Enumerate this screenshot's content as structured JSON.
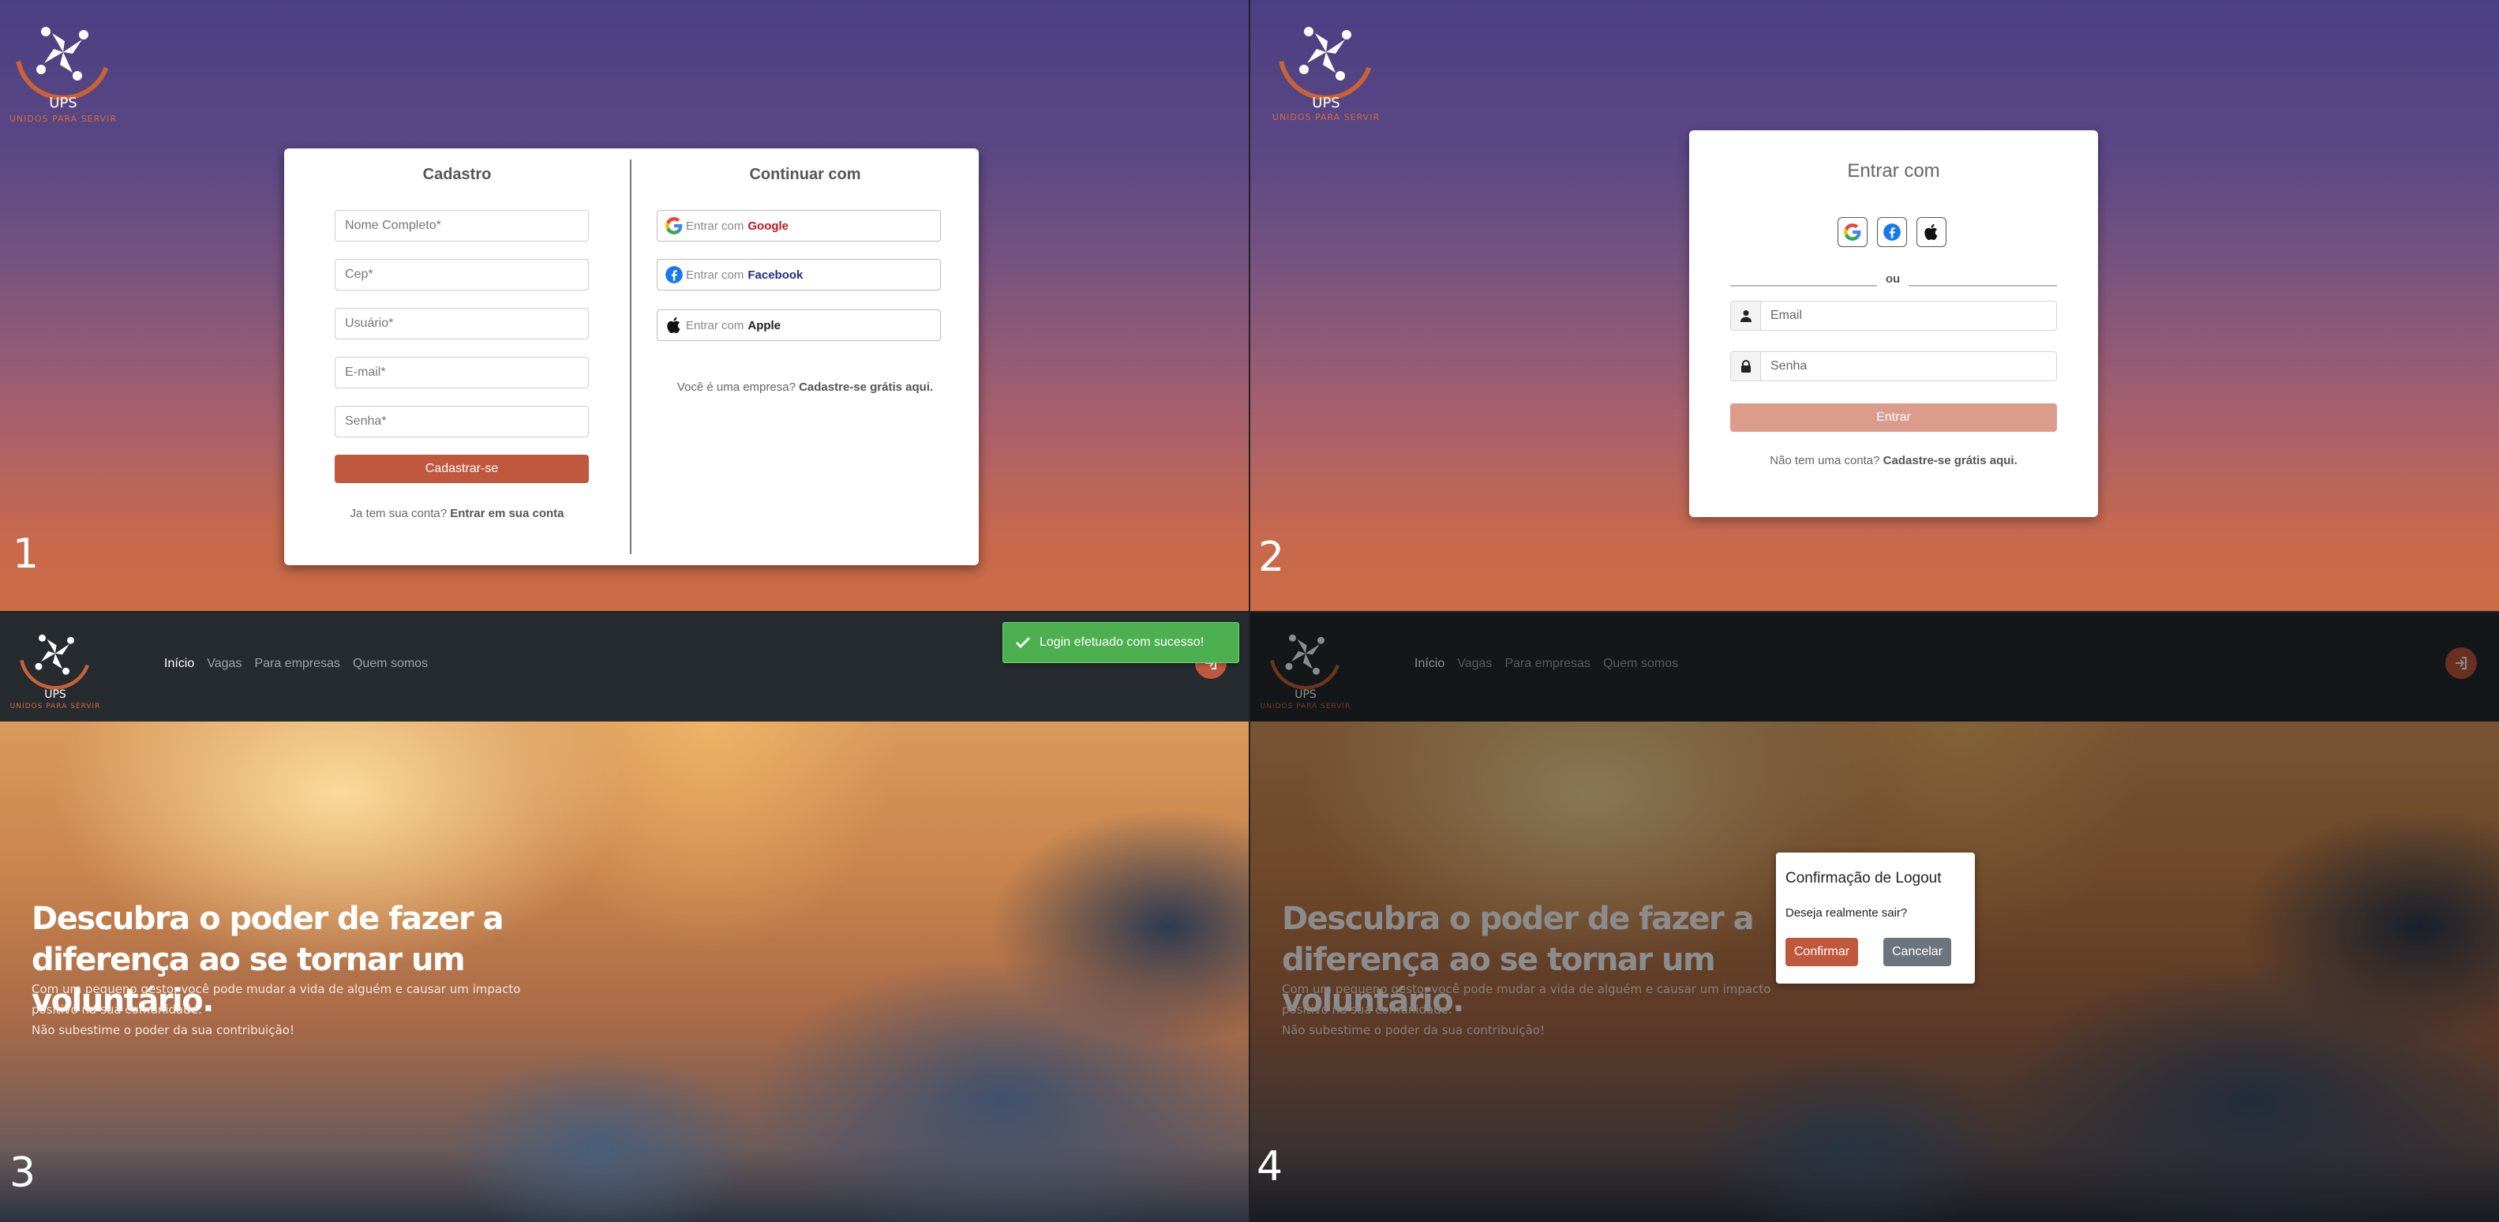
{
  "brand": {
    "name": "UPS",
    "tagline": "UNIDOS PARA SERVIR",
    "colors": {
      "accent": "#c0583d",
      "navbar": "#262b2f",
      "toast": "#4caf50"
    }
  },
  "panel_numbers": [
    "1",
    "2",
    "3",
    "4"
  ],
  "signup": {
    "title": "Cadastro",
    "fields": [
      "Nome Completo*",
      "Cep*",
      "Usuário*",
      "E-mail*",
      "Senha*"
    ],
    "submit_label": "Cadastrar-se",
    "login_prompt": "Ja tem sua conta?",
    "login_link": "Entrar em sua conta"
  },
  "continue_with": {
    "title": "Continuar com",
    "prefix": "Entrar com",
    "providers": [
      {
        "name": "Google",
        "icon": "google-icon",
        "color": "#c4161c"
      },
      {
        "name": "Facebook",
        "icon": "facebook-icon",
        "color": "#1a2f8a"
      },
      {
        "name": "Apple",
        "icon": "apple-icon",
        "color": "#222222"
      }
    ],
    "company_prompt": "Você é uma empresa?",
    "company_link": "Cadastre-se grátis aqui."
  },
  "login": {
    "title": "Entrar com",
    "social_icons": [
      "google-icon",
      "facebook-icon",
      "apple-icon"
    ],
    "separator": "ou",
    "email_placeholder": "Email",
    "password_placeholder": "Senha",
    "submit_label": "Entrar",
    "signup_prompt": "Não tem uma conta?",
    "signup_link": "Cadastre-se grátis aqui."
  },
  "navbar": {
    "links": [
      "Início",
      "Vagas",
      "Para empresas",
      "Quem somos"
    ],
    "active": "Início",
    "login_icon": "sign-in-icon"
  },
  "toast": {
    "icon": "check-icon",
    "message": "Login efetuado com sucesso!"
  },
  "hero": {
    "headline": "Descubra o poder de fazer a diferença ao se tornar um voluntário.",
    "body_line1": "Com um pequeno gesto, você pode mudar a vida de alguém e causar um impacto positivo na sua comunidade.",
    "body_line2": "Não subestime o poder da sua contribuição!"
  },
  "logout_modal": {
    "title": "Confirmação de Logout",
    "message": "Deseja realmente sair?",
    "confirm_label": "Confirmar",
    "cancel_label": "Cancelar"
  }
}
